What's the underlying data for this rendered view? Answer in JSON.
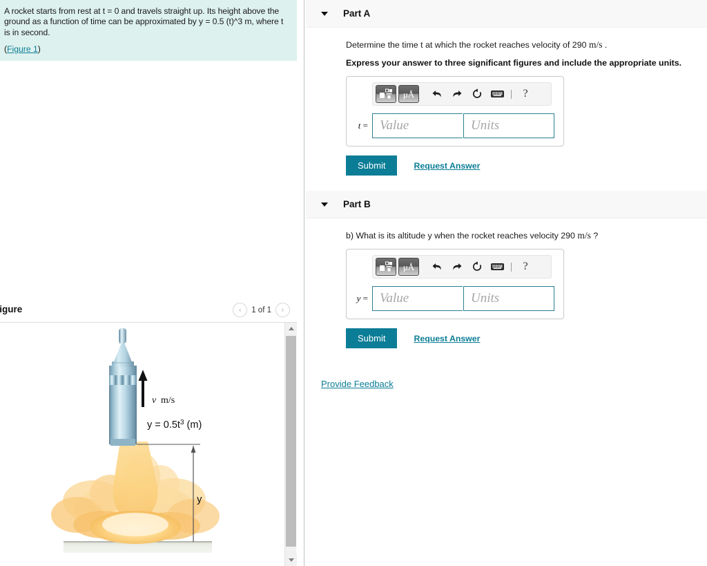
{
  "problem": {
    "statement": "A rocket starts from rest at t = 0 and travels straight up. Its height above the ground as a function of time can be approximated by y = 0.5 (t)^3 m, where t is in second.",
    "figure_link": "Figure 1",
    "paren_open": "(",
    "paren_close": ")"
  },
  "figure": {
    "title": "Figure",
    "pager_label": "1 of 1",
    "prev_icon": "chevron-left-icon",
    "next_icon": "chevron-right-icon",
    "prev_glyph": "‹",
    "next_glyph": "›",
    "scroll_up_icon": "scroll-up-arrow",
    "scroll_down_icon": "scroll-down-arrow",
    "annotations": {
      "velocity": "v m/s",
      "equation_prefix": "y = 0.5t",
      "equation_exponent": "3",
      "equation_suffix": " (m)",
      "altitude_label": "y"
    }
  },
  "parts": [
    {
      "id": "part-a",
      "title": "Part A",
      "caret_icon": "caret-down-icon",
      "prompt_pre": "Determine the time t at which the rocket reaches velocity of 290 ",
      "prompt_unit": "m/s",
      "prompt_post": " .",
      "instruction": "Express your answer to three significant figures and include the appropriate units.",
      "variable": "t",
      "equals": " =",
      "value_placeholder": "Value",
      "units_placeholder": "Units",
      "value": "",
      "units": "",
      "submit_label": "Submit",
      "request_label": "Request Answer",
      "toolbar": {
        "template_icon": "math-template-icon",
        "units_icon": "micro-angstrom-units-icon",
        "units_glyph": "μÅ",
        "undo_icon": "undo-arrow-icon",
        "redo_icon": "redo-arrow-icon",
        "reset_icon": "reset-circular-arrow-icon",
        "keyboard_icon": "keyboard-icon",
        "help_icon": "help-question-icon",
        "help_glyph": "?"
      }
    },
    {
      "id": "part-b",
      "title": "Part B",
      "caret_icon": "caret-down-icon",
      "prompt_pre": "b) What is its altitude y when the rocket reaches velocity 290 ",
      "prompt_unit": "m/s",
      "prompt_post": " ?",
      "instruction": "",
      "variable": "y",
      "equals": " =",
      "value_placeholder": "Value",
      "units_placeholder": "Units",
      "value": "",
      "units": "",
      "submit_label": "Submit",
      "request_label": "Request Answer",
      "toolbar": {
        "template_icon": "math-template-icon",
        "units_icon": "micro-angstrom-units-icon",
        "units_glyph": "μÅ",
        "undo_icon": "undo-arrow-icon",
        "redo_icon": "redo-arrow-icon",
        "reset_icon": "reset-circular-arrow-icon",
        "keyboard_icon": "keyboard-icon",
        "help_icon": "help-question-icon",
        "help_glyph": "?"
      }
    }
  ],
  "footer": {
    "provide_feedback": "Provide Feedback"
  },
  "colors": {
    "problem_bg": "#ddf1ee",
    "accent_teal": "#0c7d96",
    "link_teal": "#0b7d96",
    "part_header_bg": "#f8f8f8",
    "input_border": "#2a7f93"
  }
}
